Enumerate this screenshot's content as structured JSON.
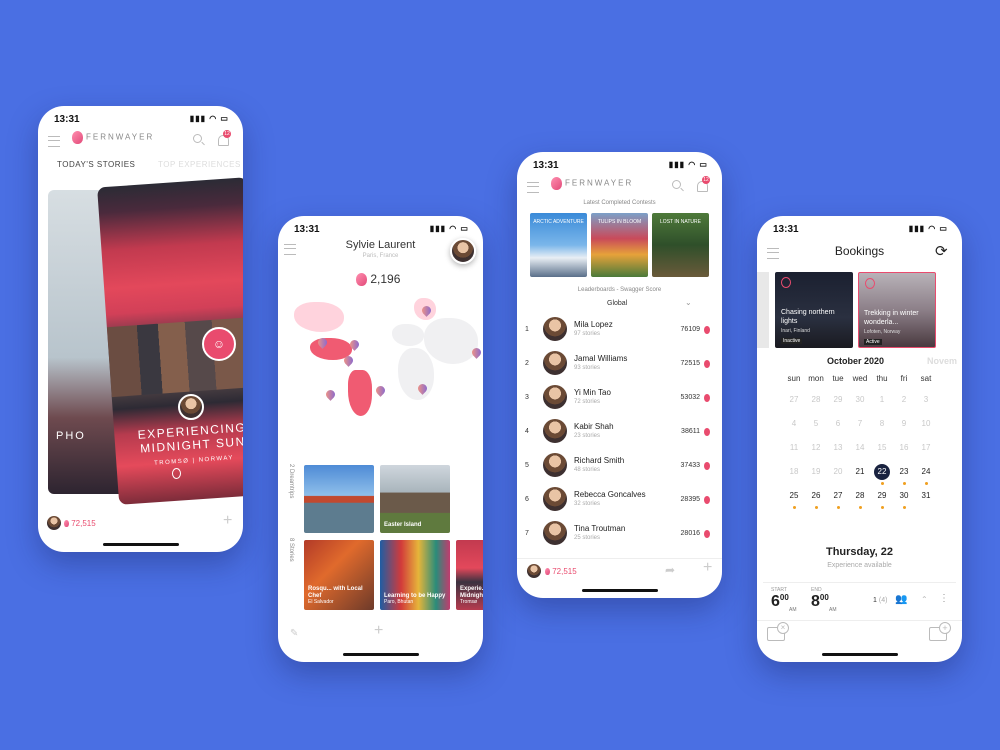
{
  "time": "13:31",
  "brand": "FERNWAYER",
  "notification_count": "12",
  "phone1": {
    "tabs": [
      "TODAY'S STORIES",
      "TOP EXPERIENCES"
    ],
    "back_card_text": "PHO",
    "story_title_line1": "EXPERIENCING",
    "story_title_line2": "MIDNIGHT SUN",
    "story_location": "TROMSØ | NORWAY",
    "score": "72,515"
  },
  "phone2": {
    "user_name": "Sylvie  Laurent",
    "user_location": "Paris, France",
    "score": "2,196",
    "dreamtrips_label": "2 Dreamtrips",
    "stories_label": "8 Stories",
    "dreamtrips": [
      {
        "caption": ""
      },
      {
        "caption": "Easter Island"
      }
    ],
    "stories": [
      {
        "caption": "Rosqu... with Local Chef",
        "sub": "El Salvador"
      },
      {
        "caption": "Learning to be Happy",
        "sub": "Paro, Bhutan"
      },
      {
        "caption": "Experie... Midnigh...",
        "sub": "Tromsø"
      }
    ]
  },
  "phone3": {
    "contests_title": "Latest Completed Contests",
    "contests": [
      "ARCTIC ADVENTURE",
      "TULIPS IN BLOOM",
      "LOST IN NATURE"
    ],
    "leaderboard_title": "Leaderboards - Swagger Score",
    "filter": "Global",
    "rows": [
      {
        "rank": "1",
        "name": "Mila Lopez",
        "stories": "97 stories",
        "score": "76109"
      },
      {
        "rank": "2",
        "name": "Jamal Williams",
        "stories": "93 stories",
        "score": "72515"
      },
      {
        "rank": "3",
        "name": "Yi Min Tao",
        "stories": "72 stories",
        "score": "53032"
      },
      {
        "rank": "4",
        "name": "Kabir Shah",
        "stories": "23 stories",
        "score": "38611"
      },
      {
        "rank": "5",
        "name": "Richard Smith",
        "stories": "48 stories",
        "score": "37433"
      },
      {
        "rank": "6",
        "name": "Rebecca Goncalves",
        "stories": "32 stories",
        "score": "28395"
      },
      {
        "rank": "7",
        "name": "Tina Troutman",
        "stories": "25 stories",
        "score": "28016"
      }
    ],
    "my_score": "72,515"
  },
  "phone4": {
    "title": "Bookings",
    "cards": [
      {
        "title": "Chasing northern lights",
        "place": "Inari, Finland",
        "status": "Inactive"
      },
      {
        "title": "Trekking in winter wonderla...",
        "place": "Lofoten, Norway",
        "status": "Active"
      }
    ],
    "month": "October 2020",
    "next_month": "Novem",
    "weekdays": [
      "sun",
      "mon",
      "tue",
      "wed",
      "thu",
      "fri",
      "sat"
    ],
    "weeks": [
      [
        "27",
        "28",
        "29",
        "30",
        "1",
        "2",
        "3"
      ],
      [
        "4",
        "5",
        "6",
        "7",
        "8",
        "9",
        "10"
      ],
      [
        "11",
        "12",
        "13",
        "14",
        "15",
        "16",
        "17"
      ],
      [
        "18",
        "19",
        "20",
        "21",
        "22",
        "23",
        "24"
      ],
      [
        "25",
        "26",
        "27",
        "28",
        "29",
        "30",
        "31"
      ]
    ],
    "selected_day": "Thursday, 22",
    "availability": "Experience available",
    "start_label": "START",
    "start_hour": "6",
    "start_min": "00",
    "start_ampm": "AM",
    "end_label": "END",
    "end_hour": "8",
    "end_min": "00",
    "end_ampm": "AM",
    "guests": "1",
    "capacity": "(4)"
  }
}
